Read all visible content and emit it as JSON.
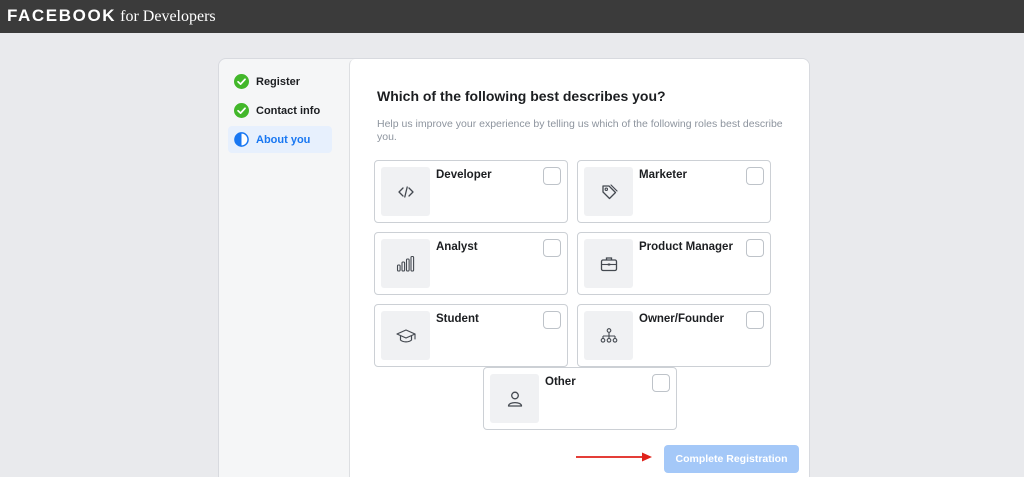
{
  "brand": {
    "name": "FACEBOOK",
    "suffix": "for Developers"
  },
  "steps": [
    {
      "label": "Register",
      "state": "complete",
      "icon": "check-circle-icon"
    },
    {
      "label": "Contact info",
      "state": "complete",
      "icon": "check-circle-icon"
    },
    {
      "label": "About you",
      "state": "current",
      "icon": "half-circle-icon"
    }
  ],
  "main": {
    "title": "Which of the following best describes you?",
    "subtitle": "Help us improve your experience by telling us which of the following roles best describe you."
  },
  "roles": [
    {
      "label": "Developer",
      "icon": "code-icon",
      "checked": false
    },
    {
      "label": "Marketer",
      "icon": "tag-icon",
      "checked": false
    },
    {
      "label": "Analyst",
      "icon": "bar-chart-icon",
      "checked": false
    },
    {
      "label": "Product Manager",
      "icon": "briefcase-icon",
      "checked": false
    },
    {
      "label": "Student",
      "icon": "graduation-cap-icon",
      "checked": false
    },
    {
      "label": "Owner/Founder",
      "icon": "org-chart-icon",
      "checked": false
    },
    {
      "label": "Other",
      "icon": "person-icon",
      "checked": false
    }
  ],
  "actions": {
    "complete_label": "Complete Registration"
  },
  "colors": {
    "topbar": "#3b3b3b",
    "success_green": "#42b72a",
    "active_blue": "#1877f2",
    "button_disabled": "#a4c8f8",
    "annotation_arrow": "#e0221b"
  }
}
